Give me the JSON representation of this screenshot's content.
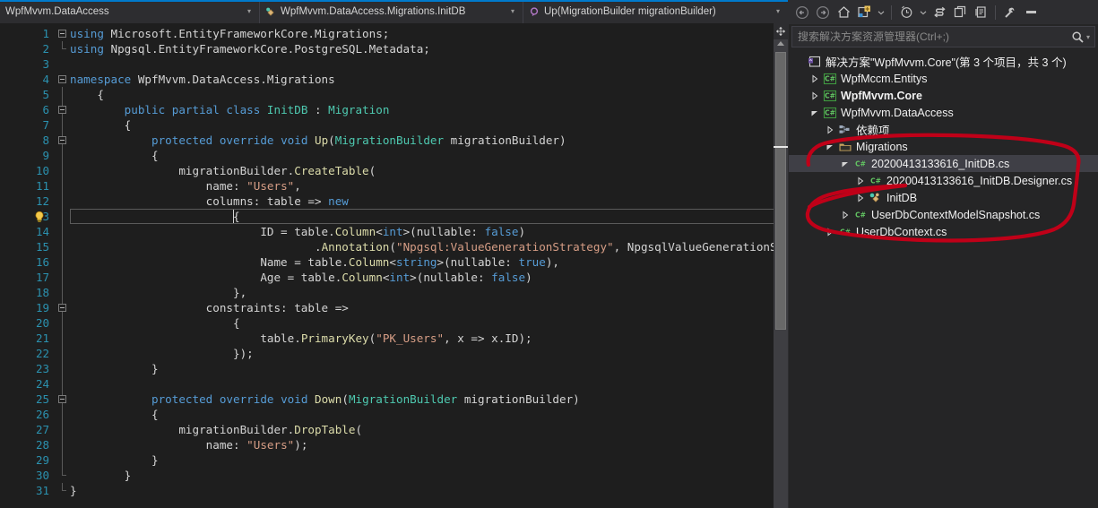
{
  "window": {
    "theme_accent": "#007acc",
    "editor_bg": "#1e1e1e",
    "panel_bg": "#252526",
    "annotation_color": "#c00018"
  },
  "nav_bar": {
    "project_combo": {
      "value": "WpfMvvm.DataAccess",
      "icon": "none"
    },
    "type_combo": {
      "value": "WpfMvvm.DataAccess.Migrations.InitDB",
      "icon": "class-icon"
    },
    "member_combo": {
      "value": "Up(MigrationBuilder migrationBuilder)",
      "icon": "method-icon"
    },
    "dropdown_arrow": "▾"
  },
  "editor": {
    "lines": [
      {
        "n": "1",
        "fold": "open",
        "indent": 0,
        "bar": false,
        "tokens": [
          {
            "t": "using ",
            "c": "kw"
          },
          {
            "t": "Microsoft.EntityFrameworkCore.Migrations;",
            "c": "pln"
          }
        ]
      },
      {
        "n": "2",
        "fold": "none",
        "indent": 0,
        "bar": "end",
        "tokens": [
          {
            "t": "using ",
            "c": "kw"
          },
          {
            "t": "Npgsql.EntityFrameworkCore.PostgreSQL.Metadata;",
            "c": "pln"
          }
        ]
      },
      {
        "n": "3",
        "fold": "none",
        "indent": 0,
        "bar": false,
        "tokens": []
      },
      {
        "n": "4",
        "fold": "open",
        "indent": 0,
        "bar": false,
        "tokens": [
          {
            "t": "namespace ",
            "c": "kw"
          },
          {
            "t": "WpfMvvm.DataAccess.Migrations",
            "c": "pln"
          }
        ]
      },
      {
        "n": "5",
        "fold": "none",
        "indent": 1,
        "bar": "line",
        "tokens": [
          {
            "t": "{",
            "c": "pln"
          }
        ]
      },
      {
        "n": "6",
        "fold": "open",
        "indent": 2,
        "bar": "line",
        "tokens": [
          {
            "t": "public ",
            "c": "kw"
          },
          {
            "t": "partial ",
            "c": "kw"
          },
          {
            "t": "class ",
            "c": "kw"
          },
          {
            "t": "InitDB",
            "c": "typ"
          },
          {
            "t": " : ",
            "c": "pln"
          },
          {
            "t": "Migration",
            "c": "typ"
          }
        ]
      },
      {
        "n": "7",
        "fold": "none",
        "indent": 2,
        "bar": "line",
        "tokens": [
          {
            "t": "{",
            "c": "pln"
          }
        ]
      },
      {
        "n": "8",
        "fold": "open",
        "indent": 3,
        "bar": "line",
        "tokens": [
          {
            "t": "protected ",
            "c": "kw"
          },
          {
            "t": "override ",
            "c": "kw"
          },
          {
            "t": "void ",
            "c": "kw"
          },
          {
            "t": "Up",
            "c": "ctl"
          },
          {
            "t": "(",
            "c": "pln"
          },
          {
            "t": "MigrationBuilder",
            "c": "typ"
          },
          {
            "t": " migrationBuilder)",
            "c": "pln"
          }
        ]
      },
      {
        "n": "9",
        "fold": "none",
        "indent": 3,
        "bar": "line",
        "tokens": [
          {
            "t": "{",
            "c": "pln"
          }
        ]
      },
      {
        "n": "10",
        "fold": "none",
        "indent": 4,
        "bar": "line",
        "tokens": [
          {
            "t": "migrationBuilder.",
            "c": "pln"
          },
          {
            "t": "CreateTable",
            "c": "ctl"
          },
          {
            "t": "(",
            "c": "pln"
          }
        ]
      },
      {
        "n": "11",
        "fold": "none",
        "indent": 5,
        "bar": "line",
        "tokens": [
          {
            "t": "name: ",
            "c": "pln"
          },
          {
            "t": "\"Users\"",
            "c": "str"
          },
          {
            "t": ",",
            "c": "pln"
          }
        ]
      },
      {
        "n": "12",
        "fold": "none",
        "indent": 5,
        "bar": "line",
        "tokens": [
          {
            "t": "columns: table => ",
            "c": "pln"
          },
          {
            "t": "new",
            "c": "kw"
          }
        ]
      },
      {
        "n": "13",
        "fold": "none",
        "indent": 6,
        "bar": "line",
        "current": true,
        "caret": true,
        "tokens": [
          {
            "t": "{",
            "c": "pln"
          }
        ]
      },
      {
        "n": "14",
        "fold": "none",
        "indent": 7,
        "bar": "line",
        "tokens": [
          {
            "t": "ID = table.",
            "c": "pln"
          },
          {
            "t": "Column",
            "c": "ctl"
          },
          {
            "t": "<",
            "c": "pln"
          },
          {
            "t": "int",
            "c": "gen"
          },
          {
            "t": ">(nullable: ",
            "c": "pln"
          },
          {
            "t": "false",
            "c": "gen"
          },
          {
            "t": ")",
            "c": "pln"
          }
        ]
      },
      {
        "n": "15",
        "fold": "none",
        "indent": 9,
        "bar": "line",
        "tokens": [
          {
            "t": ".",
            "c": "pln"
          },
          {
            "t": "Annotation",
            "c": "ctl"
          },
          {
            "t": "(",
            "c": "pln"
          },
          {
            "t": "\"Npgsql:ValueGenerationStrategy\"",
            "c": "str"
          },
          {
            "t": ", NpgsqlValueGenerationStrate",
            "c": "pln"
          }
        ]
      },
      {
        "n": "16",
        "fold": "none",
        "indent": 7,
        "bar": "line",
        "tokens": [
          {
            "t": "Name = table.",
            "c": "pln"
          },
          {
            "t": "Column",
            "c": "ctl"
          },
          {
            "t": "<",
            "c": "pln"
          },
          {
            "t": "string",
            "c": "gen"
          },
          {
            "t": ">(nullable: ",
            "c": "pln"
          },
          {
            "t": "true",
            "c": "gen"
          },
          {
            "t": "),",
            "c": "pln"
          }
        ]
      },
      {
        "n": "17",
        "fold": "none",
        "indent": 7,
        "bar": "line",
        "tokens": [
          {
            "t": "Age = table.",
            "c": "pln"
          },
          {
            "t": "Column",
            "c": "ctl"
          },
          {
            "t": "<",
            "c": "pln"
          },
          {
            "t": "int",
            "c": "gen"
          },
          {
            "t": ">(nullable: ",
            "c": "pln"
          },
          {
            "t": "false",
            "c": "gen"
          },
          {
            "t": ")",
            "c": "pln"
          }
        ]
      },
      {
        "n": "18",
        "fold": "none",
        "indent": 6,
        "bar": "line",
        "tokens": [
          {
            "t": "},",
            "c": "pln"
          }
        ]
      },
      {
        "n": "19",
        "fold": "open",
        "indent": 5,
        "bar": "line",
        "tokens": [
          {
            "t": "constraints: table =>",
            "c": "pln"
          }
        ]
      },
      {
        "n": "20",
        "fold": "none",
        "indent": 6,
        "bar": "line",
        "tokens": [
          {
            "t": "{",
            "c": "pln"
          }
        ]
      },
      {
        "n": "21",
        "fold": "none",
        "indent": 7,
        "bar": "line",
        "tokens": [
          {
            "t": "table.",
            "c": "pln"
          },
          {
            "t": "PrimaryKey",
            "c": "ctl"
          },
          {
            "t": "(",
            "c": "pln"
          },
          {
            "t": "\"PK_Users\"",
            "c": "str"
          },
          {
            "t": ", x => x.ID);",
            "c": "pln"
          }
        ]
      },
      {
        "n": "22",
        "fold": "none",
        "indent": 6,
        "bar": "line",
        "tokens": [
          {
            "t": "});",
            "c": "pln"
          }
        ]
      },
      {
        "n": "23",
        "fold": "none",
        "indent": 3,
        "bar": "line",
        "tokens": [
          {
            "t": "}",
            "c": "pln"
          }
        ]
      },
      {
        "n": "24",
        "fold": "none",
        "indent": 3,
        "bar": "line",
        "tokens": []
      },
      {
        "n": "25",
        "fold": "open",
        "indent": 3,
        "bar": "line",
        "tokens": [
          {
            "t": "protected ",
            "c": "kw"
          },
          {
            "t": "override ",
            "c": "kw"
          },
          {
            "t": "void ",
            "c": "kw"
          },
          {
            "t": "Down",
            "c": "ctl"
          },
          {
            "t": "(",
            "c": "pln"
          },
          {
            "t": "MigrationBuilder",
            "c": "typ"
          },
          {
            "t": " migrationBuilder)",
            "c": "pln"
          }
        ]
      },
      {
        "n": "26",
        "fold": "none",
        "indent": 3,
        "bar": "line",
        "tokens": [
          {
            "t": "{",
            "c": "pln"
          }
        ]
      },
      {
        "n": "27",
        "fold": "none",
        "indent": 4,
        "bar": "line",
        "tokens": [
          {
            "t": "migrationBuilder.",
            "c": "pln"
          },
          {
            "t": "DropTable",
            "c": "ctl"
          },
          {
            "t": "(",
            "c": "pln"
          }
        ]
      },
      {
        "n": "28",
        "fold": "none",
        "indent": 5,
        "bar": "line",
        "tokens": [
          {
            "t": "name: ",
            "c": "pln"
          },
          {
            "t": "\"Users\"",
            "c": "str"
          },
          {
            "t": ");",
            "c": "pln"
          }
        ]
      },
      {
        "n": "29",
        "fold": "none",
        "indent": 3,
        "bar": "line",
        "tokens": [
          {
            "t": "}",
            "c": "pln"
          }
        ]
      },
      {
        "n": "30",
        "fold": "none",
        "indent": 2,
        "bar": "end",
        "tokens": [
          {
            "t": "}",
            "c": "pln"
          }
        ]
      },
      {
        "n": "31",
        "fold": "none",
        "indent": 0,
        "bar": "end",
        "tokens": [
          {
            "t": "}",
            "c": "pln"
          }
        ]
      }
    ],
    "lightbulb_line": "13",
    "lightbulb_tooltip": "Show potential fixes"
  },
  "solution_explorer": {
    "toolbar": [
      {
        "name": "back-button",
        "glyph": "←"
      },
      {
        "name": "forward-button",
        "glyph": "→"
      },
      {
        "name": "home-button",
        "glyph": "⌂"
      },
      {
        "name": "sync-with-active-document-button",
        "glyph": "▣"
      },
      {
        "name": "sync-dropdown-arrow",
        "glyph": "▾"
      },
      {
        "name": "pending-changes-filter-button",
        "glyph": "◷"
      },
      {
        "name": "filter-dropdown-arrow",
        "glyph": "▾"
      },
      {
        "name": "refresh-button",
        "glyph": "⇄"
      },
      {
        "name": "collapse-all-button",
        "glyph": "▤"
      },
      {
        "name": "show-all-files-button",
        "glyph": "▥"
      },
      {
        "name": "properties-button",
        "glyph": "🔧"
      },
      {
        "name": "preview-selected-items-button",
        "glyph": "▬"
      }
    ],
    "search": {
      "placeholder": "搜索解决方案资源管理器(Ctrl+;)",
      "value": "",
      "dropdown_arrow": "▾"
    },
    "tree": [
      {
        "depth": 0,
        "expander": "none",
        "icon": "solution-icon",
        "label": "解决方案\"WpfMvvm.Core\"(第 3 个项目，共 3 个)",
        "bold": false,
        "selected": false
      },
      {
        "depth": 1,
        "expander": "collapsed",
        "icon": "csharp-project-icon",
        "label": "WpfMccm.Entitys",
        "bold": false,
        "selected": false
      },
      {
        "depth": 1,
        "expander": "collapsed",
        "icon": "csharp-project-icon",
        "label": "WpfMvvm.Core",
        "bold": true,
        "selected": false
      },
      {
        "depth": 1,
        "expander": "expanded",
        "icon": "csharp-project-icon",
        "label": "WpfMvvm.DataAccess",
        "bold": false,
        "selected": false
      },
      {
        "depth": 2,
        "expander": "collapsed",
        "icon": "dependencies-icon",
        "label": "依赖项",
        "bold": false,
        "selected": false
      },
      {
        "depth": 2,
        "expander": "expanded",
        "icon": "folder-icon",
        "label": "Migrations",
        "bold": false,
        "selected": false
      },
      {
        "depth": 3,
        "expander": "expanded",
        "icon": "csharp-file-icon",
        "label": "20200413133616_InitDB.cs",
        "bold": false,
        "selected": true
      },
      {
        "depth": 4,
        "expander": "collapsed",
        "icon": "csharp-file-icon",
        "label": "20200413133616_InitDB.Designer.cs",
        "bold": false,
        "selected": false
      },
      {
        "depth": 4,
        "expander": "collapsed",
        "icon": "class-icon",
        "label": "InitDB",
        "bold": false,
        "selected": false
      },
      {
        "depth": 3,
        "expander": "collapsed",
        "icon": "csharp-file-icon",
        "label": "UserDbContextModelSnapshot.cs",
        "bold": false,
        "selected": false
      },
      {
        "depth": 2,
        "expander": "collapsed",
        "icon": "csharp-file-icon",
        "label": "UserDbContext.cs",
        "bold": false,
        "selected": false
      }
    ]
  },
  "annotation": {
    "type": "hand-drawn-circle",
    "color": "#c00018",
    "encircles": "Migrations folder through UserDbContext.cs"
  }
}
